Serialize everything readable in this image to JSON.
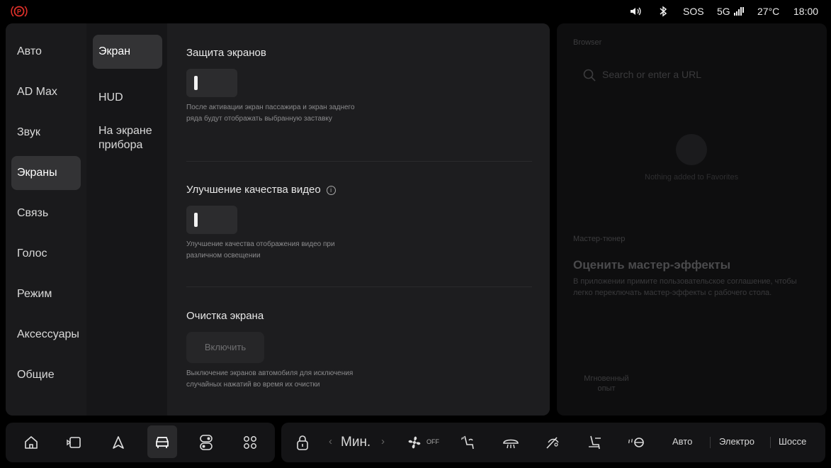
{
  "status": {
    "parking_icon": "parking-brake-icon",
    "volume_icon": "volume-icon",
    "bluetooth_icon": "bluetooth-icon",
    "sos": "SOS",
    "network": "5G",
    "temperature": "27°C",
    "time": "18:00",
    "parking_color": "#e0312a"
  },
  "nav1": {
    "items": [
      "Авто",
      "AD Max",
      "Звук",
      "Экраны",
      "Связь",
      "Голос",
      "Режим",
      "Аксессуары",
      "Общие"
    ],
    "active": "Экраны"
  },
  "nav2": {
    "items": [
      "Экран",
      "HUD",
      "На экране прибора"
    ],
    "active": "Экран"
  },
  "content": {
    "screen_protection": {
      "title": "Защита экранов",
      "desc": "После активации экран пассажира и экран заднего ряда будут отображать выбранную заставку"
    },
    "video_enhance": {
      "title": "Улучшение качества видео",
      "info": "i",
      "desc": "Улучшение качества отображения видео при различном освещении"
    },
    "screen_clean": {
      "title": "Очистка экрана",
      "button": "Включить",
      "desc": "Выключение экранов автомобиля для исключения случайных нажатий во время их очистки"
    }
  },
  "right": {
    "browser_label": "Browser",
    "search_placeholder": "Search or enter a URL",
    "no_favorites": "Nothing added to Favorites",
    "tuner_label": "Мастер-тюнер",
    "tuner_title": "Оценить мастер-эффекты",
    "tuner_desc": "В приложении примите пользовательское соглашение, чтобы легко переключать мастер-эффекты с рабочего стола.",
    "instant": "Мгновенный опыт"
  },
  "dock": {
    "fan_level": "Мин.",
    "fan_state": "OFF",
    "modes": [
      "Авто",
      "Электро",
      "Шоссе"
    ]
  }
}
